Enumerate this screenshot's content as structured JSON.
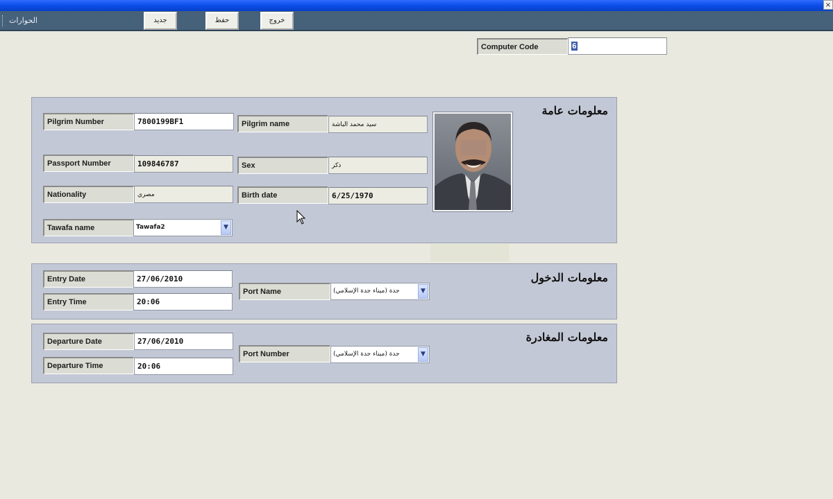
{
  "window": {
    "close_glyph": "×"
  },
  "toolbar": {
    "title": "الحوارات",
    "new_label": "جديد",
    "save_label": "حفظ",
    "exit_label": "خروج"
  },
  "computer_code": {
    "label": "Computer Code",
    "value": "6"
  },
  "general": {
    "title": "معلومات عامة",
    "pilgrim_number_label": "Pilgrim Number",
    "pilgrim_number_value": "7800199BF1",
    "pilgrim_name_label": "Pilgrim name",
    "pilgrim_name_value": "سيد محمد الباشة",
    "passport_number_label": "Passport Number",
    "passport_number_value": "109846787",
    "sex_label": "Sex",
    "sex_value": "ذكر",
    "nationality_label": "Nationality",
    "nationality_value": "مصري",
    "birth_date_label": "Birth date",
    "birth_date_value": "6/25/1970",
    "tawafa_label": "Tawafa name",
    "tawafa_value": "Tawafa2"
  },
  "entry": {
    "title": "معلومات الدخول",
    "date_label": "Entry Date",
    "date_value": "27/06/2010",
    "time_label": "Entry Time",
    "time_value": "20:06",
    "port_label": "Port Name",
    "port_value": "جدة (ميناء جدة الإسلامي)"
  },
  "departure": {
    "title": "معلومات المغادرة",
    "date_label": "Departure Date",
    "date_value": "27/06/2010",
    "time_label": "Departure Time",
    "time_value": "20:06",
    "port_label": "Port Number",
    "port_value": "جدة (ميناء جدة الإسلامي)"
  }
}
